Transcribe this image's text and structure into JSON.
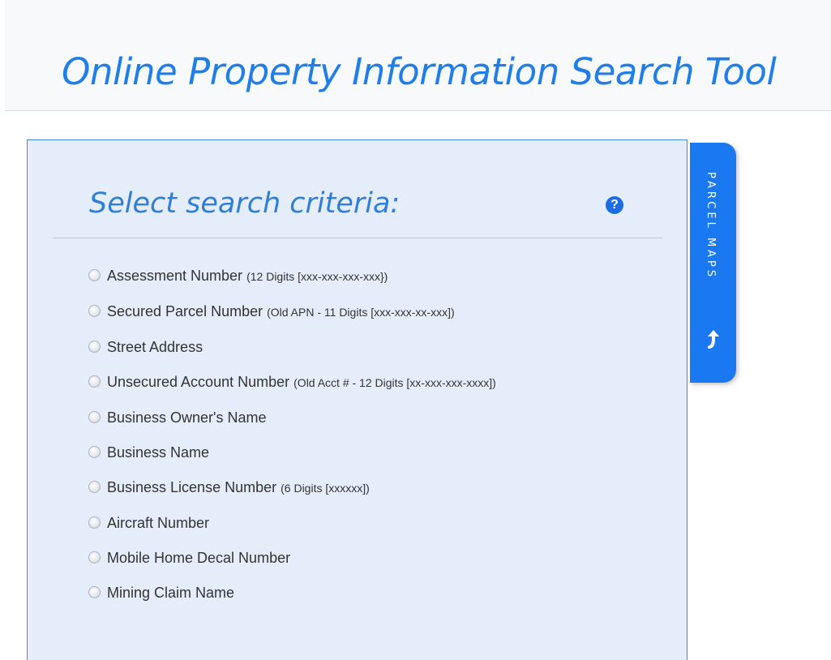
{
  "header": {
    "title": "Online Property Information Search Tool"
  },
  "panel": {
    "title": "Select search criteria:",
    "help_icon": "question-circle-icon",
    "options": [
      {
        "label": "Assessment Number",
        "hint": "(12 Digits [xxx-xxx-xxx-xxx})"
      },
      {
        "label": "Secured Parcel Number",
        "hint": "(Old APN - 11 Digits [xxx-xxx-xx-xxx])"
      },
      {
        "label": "Street Address",
        "hint": ""
      },
      {
        "label": "Unsecured Account Number",
        "hint": "(Old Acct # - 12 Digits [xx-xxx-xxx-xxxx])"
      },
      {
        "label": "Business Owner's Name",
        "hint": ""
      },
      {
        "label": "Business Name",
        "hint": ""
      },
      {
        "label": "Business License Number",
        "hint": "(6 Digits [xxxxxx])"
      },
      {
        "label": "Aircraft Number",
        "hint": ""
      },
      {
        "label": "Mobile Home Decal Number",
        "hint": ""
      },
      {
        "label": "Mining Claim Name",
        "hint": ""
      }
    ]
  },
  "side_tab": {
    "label": "PARCEL MAPS",
    "icon": "arrow-up-turn-icon"
  },
  "colors": {
    "accent": "#1a78f0",
    "panel_bg": "#e5edfb",
    "title_blue": "#2f7fd8"
  }
}
